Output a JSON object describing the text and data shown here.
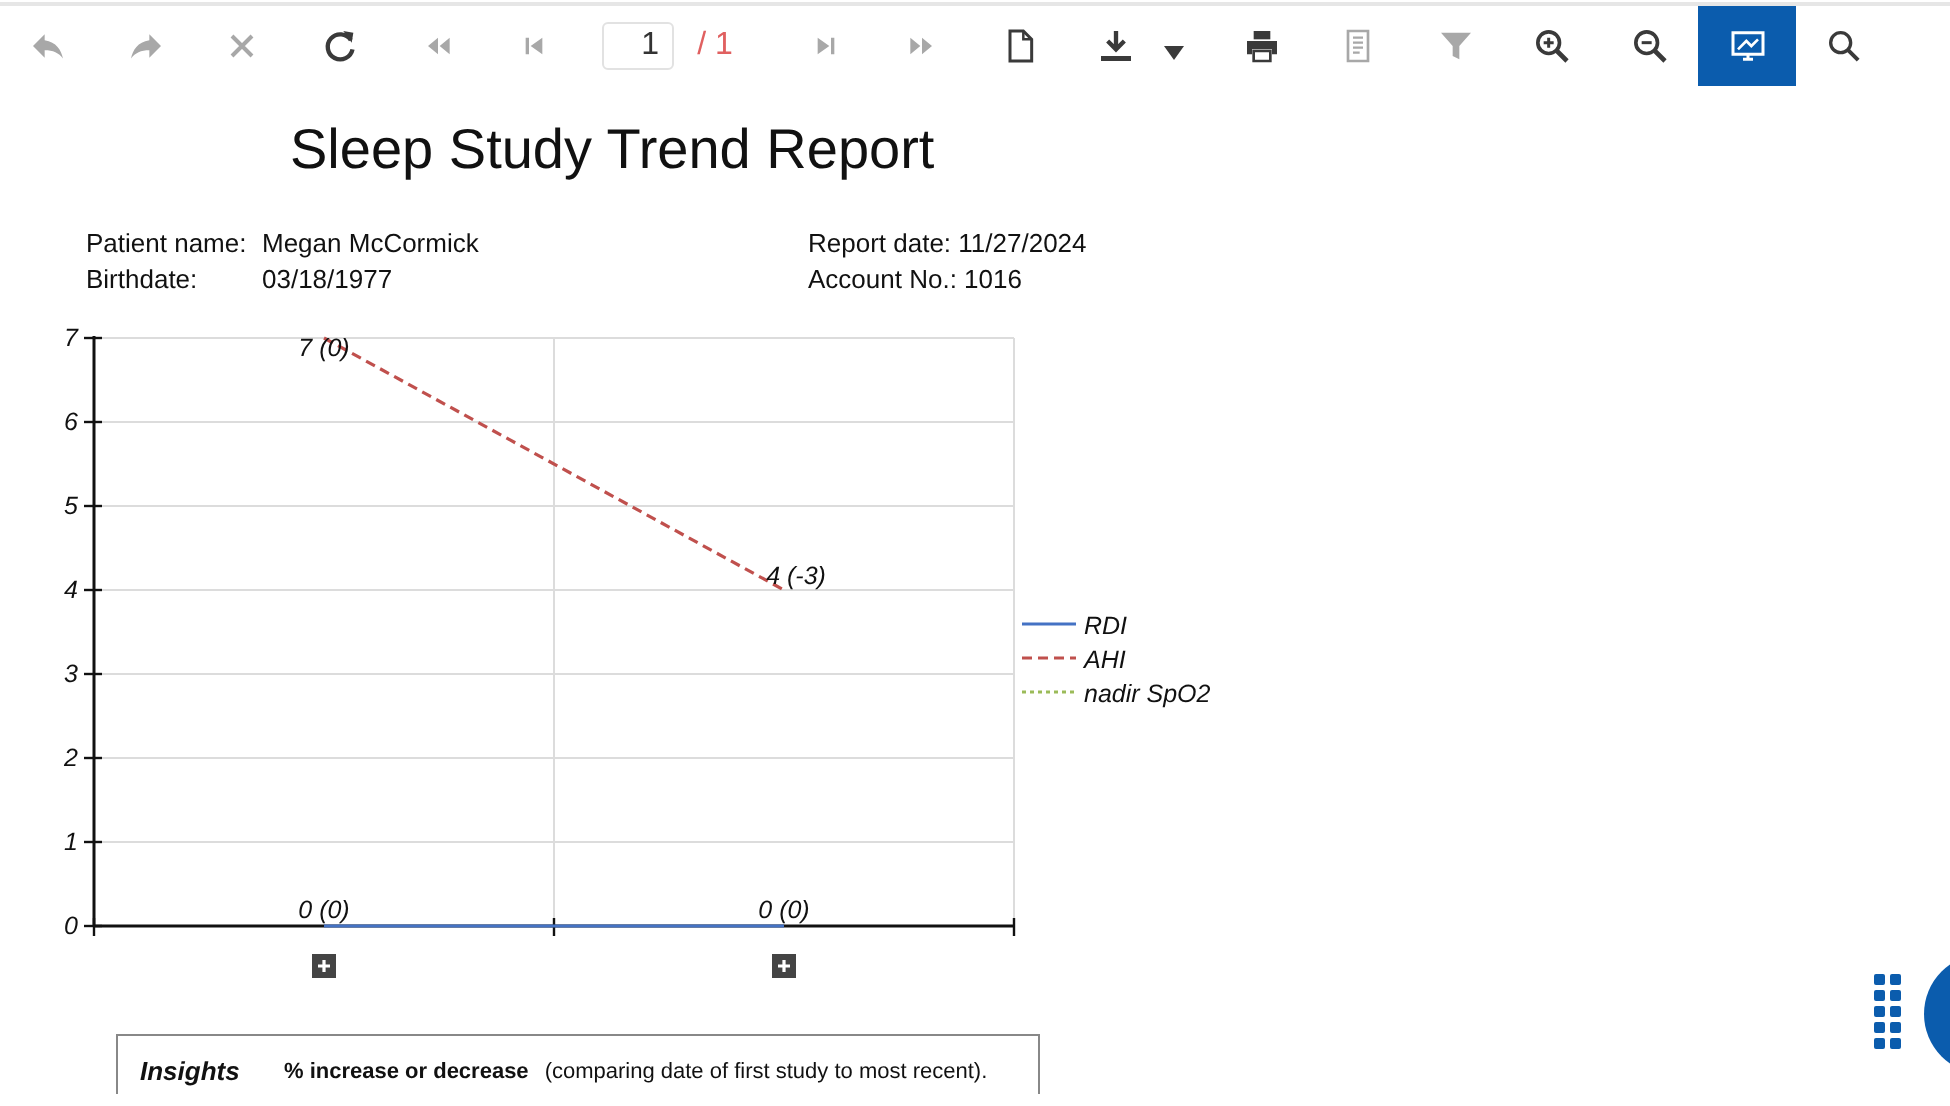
{
  "toolbar": {
    "buttons": [
      {
        "kind": "back",
        "disabled": true,
        "pressed": false
      },
      {
        "kind": "forward",
        "disabled": true,
        "pressed": false
      },
      {
        "kind": "close",
        "disabled": true,
        "pressed": false
      },
      {
        "kind": "refresh",
        "disabled": false,
        "pressed": false
      },
      {
        "kind": "previous",
        "disabled": true,
        "pressed": false
      },
      {
        "kind": "first",
        "disabled": true,
        "pressed": false
      }
    ],
    "page": {
      "value": "1",
      "total": "/ 1"
    },
    "more_buttons": [
      {
        "kind": "next",
        "disabled": true,
        "pressed": false
      },
      {
        "kind": "last",
        "disabled": true,
        "pressed": false
      },
      {
        "kind": "page",
        "disabled": false,
        "pressed": false
      },
      {
        "kind": "download",
        "disabled": false,
        "pressed": false
      },
      {
        "kind": "print",
        "disabled": false,
        "pressed": false
      },
      {
        "kind": "report",
        "disabled": true,
        "pressed": false
      },
      {
        "kind": "filter",
        "disabled": true,
        "pressed": false
      },
      {
        "kind": "zoom_in",
        "disabled": false,
        "pressed": false
      },
      {
        "kind": "zoom_out",
        "disabled": false,
        "pressed": false
      },
      {
        "kind": "display",
        "disabled": false,
        "pressed": true
      },
      {
        "kind": "search",
        "disabled": false,
        "pressed": false
      }
    ]
  },
  "report": {
    "title": "Sleep Study Trend Report",
    "info_left": [
      {
        "label": "Patient name:",
        "value": "Megan McCormick"
      },
      {
        "label": "Birthdate:",
        "value": "03/18/1977"
      }
    ],
    "info_right": [
      "Report date: 11/27/2024",
      "Account No.: 1016"
    ]
  },
  "chart": {
    "chart_data": {
      "type": "line",
      "ylim": [
        0,
        7
      ],
      "yticks": [
        {
          "value": 0,
          "label": "0"
        },
        {
          "value": 1,
          "label": "1"
        },
        {
          "value": 2,
          "label": "2"
        },
        {
          "value": 3,
          "label": "3"
        },
        {
          "value": 4,
          "label": "4"
        },
        {
          "value": 5,
          "label": "5"
        },
        {
          "value": 6,
          "label": "6"
        },
        {
          "value": 7,
          "label": "7"
        }
      ],
      "categories": [
        null,
        null
      ],
      "grid": true,
      "legend": true,
      "series": [
        {
          "name": "RDI",
          "color": "#4472c4",
          "line_style": "solid",
          "values": [
            0,
            0
          ],
          "value_labels": [
            "0 (0)",
            "0 (0)"
          ]
        },
        {
          "name": "AHI",
          "color": "#c0504d",
          "line_style": "dashed",
          "values": [
            7,
            4
          ],
          "value_labels": [
            "7 (0)",
            "4 (-3)"
          ]
        },
        {
          "name": "nadir SpO2",
          "color": "#9bbb59",
          "line_style": "dotted",
          "values": [
            null,
            null
          ]
        }
      ]
    }
  },
  "insights": {
    "title": "Insights",
    "heading": "% increase or decrease",
    "note": "(comparing date of first study to most recent)."
  }
}
